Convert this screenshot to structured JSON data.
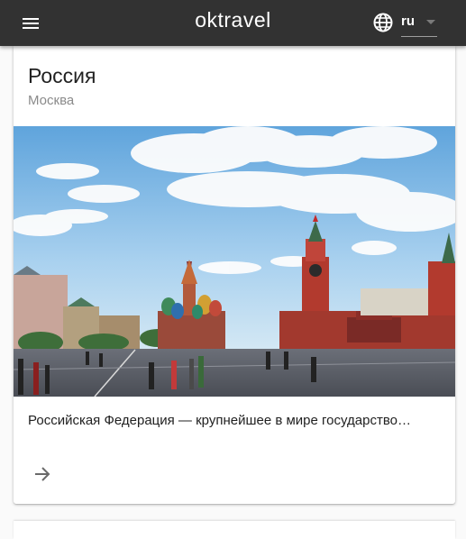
{
  "appbar": {
    "brand": "oktravel",
    "menu_icon": "hamburger-menu-icon",
    "language": {
      "icon": "globe-icon",
      "selected": "ru"
    }
  },
  "card": {
    "title": "Россия",
    "subtitle": "Москва",
    "image_subject": "red-square-photo",
    "description": "Российская Федерация — крупнейшее в мире государство…",
    "action_icon": "arrow-right-icon"
  },
  "colors": {
    "appbar_bg": "#323232",
    "page_bg": "#fafafa"
  }
}
